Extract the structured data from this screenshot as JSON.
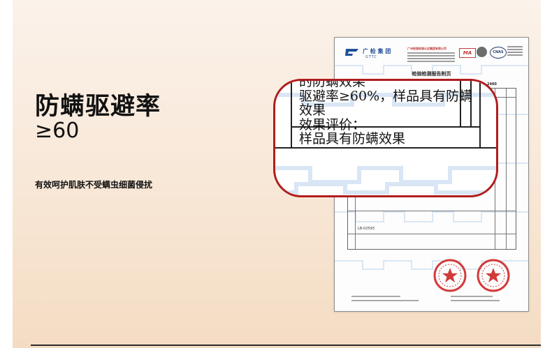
{
  "headline": "防螨驱避率",
  "value": "≥60",
  "subline": "有效呵护肌肤不受螨虫细菌侵扰",
  "report": {
    "title": "检验检测报告附页",
    "logo_text": "广 检 集 团",
    "logo_en": "GTTC",
    "company": "广州检验检测认证集团有限公司",
    "cert_ma": "MA",
    "cert_cnas": "CNAS",
    "report_no_fragment": "2460",
    "table_note": "LB-02593"
  },
  "magnified": {
    "line1": "的防螨效果",
    "line2": "驱避率≥60%，样品具有防螨",
    "line3": "效果",
    "line4": "效果评价：",
    "line5": "样品具有防螨效果"
  },
  "colors": {
    "accent": "#b11d1d",
    "brand_blue": "#1f4f9a",
    "seal_red": "#d23a3a"
  }
}
